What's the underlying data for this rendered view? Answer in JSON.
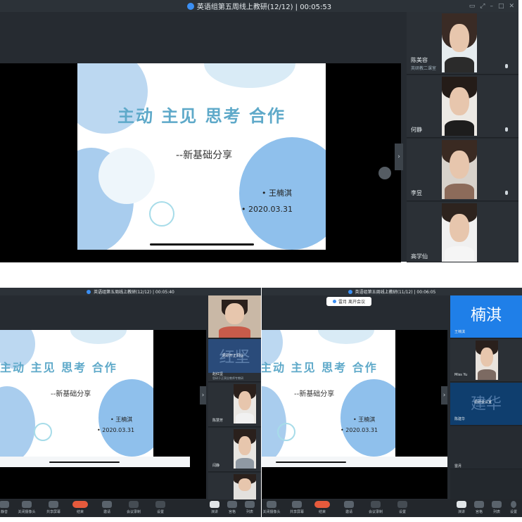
{
  "top": {
    "title": "英语组第五周线上教研(12/12) | 00:05:53",
    "participants": [
      {
        "name": "陈美容",
        "sub": "英研教二课室"
      },
      {
        "name": "何静",
        "sub": ""
      },
      {
        "name": "李昱",
        "sub": ""
      },
      {
        "name": "高学仙",
        "sub": ""
      }
    ]
  },
  "slide": {
    "title": "主动 主见 思考 合作",
    "subtitle": "--新基础分享",
    "name": "• 王楠淇",
    "date": "• 2020.03.31"
  },
  "bottom_left": {
    "title": "英语组第五周线上教研(12/12) | 00:05:40",
    "slide_title": "主动 主见 思考 合作",
    "participants": [
      {
        "name": "",
        "sub": ""
      },
      {
        "name": "赵红坚",
        "sub": "思研于正洞业教师专教研",
        "avatar_text": "红坚",
        "avatar_caption": "思研开正洞业"
      },
      {
        "name": "陈慧芳",
        "sub": ""
      },
      {
        "name": "闫静",
        "sub": ""
      },
      {
        "name": "",
        "sub": ""
      }
    ],
    "toolbar": [
      {
        "label": "静音"
      },
      {
        "label": "关闭摄像头"
      },
      {
        "label": "共享屏幕"
      },
      {
        "label": "结束"
      },
      {
        "label": "邀请"
      },
      {
        "label": "会议录制"
      },
      {
        "label": "设置"
      }
    ],
    "view_labels": [
      "演讲",
      "宫格",
      "列表"
    ]
  },
  "bottom_right": {
    "title": "英语组第五周线上教研(11/12) | 00:06:05",
    "notice": "雷月 离开会议",
    "participants": [
      {
        "name": "王楠淇",
        "avatar_text": "楠淇"
      },
      {
        "name": "Miss Yu",
        "sub": ""
      },
      {
        "name": "陈建华",
        "avatar_text": "建华",
        "avatar_caption": "思研会议室"
      },
      {
        "name": "雷月",
        "sub": ""
      }
    ],
    "toolbar": [
      {
        "label": "关闭摄像头"
      },
      {
        "label": "共享屏幕"
      },
      {
        "label": "结束"
      },
      {
        "label": "邀请"
      },
      {
        "label": "会议录制"
      },
      {
        "label": "设置"
      }
    ],
    "view_labels": [
      "演讲",
      "宫格",
      "列表",
      "设置"
    ]
  },
  "colors": {
    "accent_blue": "#3b8ff3",
    "slide_title": "#5ea9c9",
    "end_call": "#e65a3c",
    "avatar_blue": "#1f7fe8",
    "avatar_dark": "#0f3e6e"
  }
}
